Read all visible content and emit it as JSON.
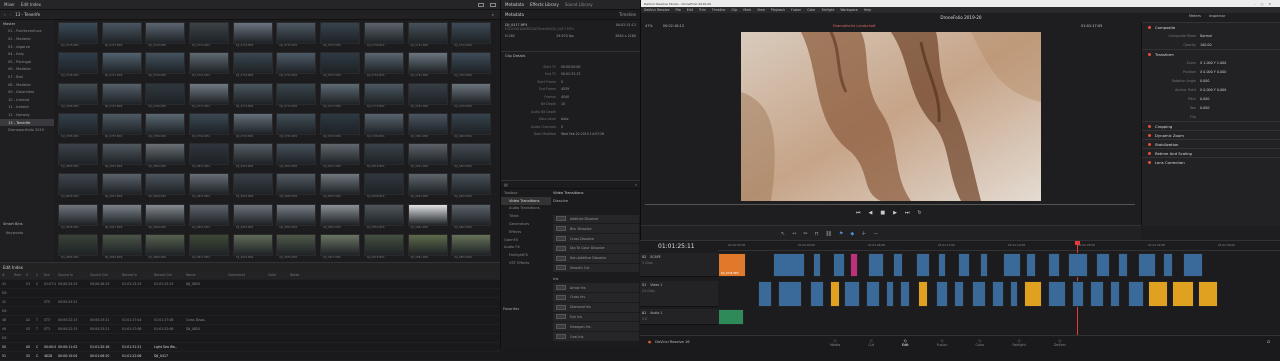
{
  "media_pool": {
    "toolbar_left": [
      "Mixer"
    ],
    "toolbar_items": [
      "Edit Index"
    ],
    "path": "13 - Tenerife",
    "master_label": "Master",
    "bins": [
      "01 - Fuerteventura",
      "02 - Madeira",
      "03 - Algarve",
      "04 - Italy",
      "05 - Portugal",
      "06 - Madeira",
      "07 - Bali",
      "08 - Madeira",
      "09 - Dolomites",
      "10 - Iceland",
      "11 - Ireland",
      "12 - Norway",
      "13 - Tenerife",
      "Droneportfolio 2019"
    ],
    "selected_bin": "13 - Tenerife",
    "smart_bins_label": "Smart Bins",
    "keywords_label": "Keywords",
    "thumbnails": [
      "DJI_0725.MP4",
      "DJI_0727.MP4",
      "DJI_0729.MP4",
      "DJI_0731.MP4",
      "DJI_0733.MP4",
      "DJI_0735.MP4",
      "DJI_0737.MP4",
      "DJI_0739.MP4",
      "DJI_0741.MP4",
      "DJI_0743.MP4",
      "DJI_0745.MP4",
      "DJI_0747.MP4",
      "DJI_0749.MP4",
      "DJI_0751.MP4",
      "DJI_0753.MP4",
      "DJI_0755.MP4",
      "DJI_0757.MP4",
      "DJI_0759.MP4",
      "DJI_0761.MP4",
      "DJI_0763.MP4",
      "DJI_0765.MP4",
      "DJI_0767.MP4",
      "DJI_0769.MP4",
      "DJI_0771.MP4",
      "DJI_0773.MP4",
      "DJI_0775.MP4",
      "DJI_0777.MP4",
      "DJI_0779.MP4",
      "DJI_0781.MP4",
      "DJI_0783.MP4",
      "DJI_0785.MP4",
      "DJI_0787.MP4",
      "DJI_0789.MP4",
      "DJI_0791.MP4",
      "DJI_0793.MP4",
      "DJI_0795.MP4",
      "DJI_0797.MP4",
      "DJI_0799.MP4",
      "DJI_0801.MP4",
      "DJI_0803.MP4",
      "DJI_0805.MP4",
      "DJI_0807.MP4",
      "DJI_0809.MP4",
      "DJI_0811.MP4",
      "DJI_0813.MP4",
      "DJI_0815.MP4",
      "DJI_0817.MP4",
      "DJI_0819.MP4",
      "DJI_0821.MP4",
      "DJI_0823.MP4",
      "DJI_0825.MP4",
      "DJI_0827.MP4",
      "DJI_0829.MP4",
      "DJI_0831.MP4",
      "DJI_0833.MP4",
      "DJI_0835.MP4",
      "DJI_0837.MP4",
      "DJI_0839.MP4",
      "DJI_0841.MP4",
      "DJI_0843.MP4",
      "DJI_0845.MP4",
      "DJI_0847.MP4",
      "DJI_0849.MP4",
      "DJI_0851.MP4",
      "DJI_0853.MP4",
      "DJI_0855.MP4",
      "DJI_0857.MP4",
      "DJI_0859.MP4",
      "DJI_0861.MP4",
      "DJI_0863.MP4",
      "DJI_0865.MP4",
      "DJI_0867.MP4",
      "DJI_0869.MP4",
      "DJI_0871.MP4",
      "DJI_0873.MP4",
      "DJI_0875.MP4",
      "DJI_0877.MP4",
      "DJI_0879.MP4",
      "DJI_0881.MP4",
      "DJI_0883.MP4"
    ],
    "thumb_colors": [
      "#3a4a58",
      "#4a5560",
      "#5b6470",
      "#3c4348",
      "#6a7380",
      "#4d5862",
      "#38434d",
      "#5c646b",
      "#465058",
      "#3d4a56",
      "#2f3d4a",
      "#526270",
      "#44525f",
      "#606a72",
      "#3a4650",
      "#4d5a66",
      "#2e3a44",
      "#5a6670",
      "#6c7680",
      "#3f4c58",
      "#404a4f",
      "#55606a",
      "#2f383f",
      "#707a82",
      "#4a565f",
      "#39444c",
      "#5e6a74",
      "#4b5761",
      "#363f46",
      "#6b747c",
      "#33404b",
      "#4e5a64",
      "#5a6872",
      "#3b4852",
      "#64707a",
      "#424e58",
      "#2d3942",
      "#58646e",
      "#4a5460",
      "#36424c",
      "#3c444a",
      "#50585f",
      "#6a7076",
      "#2f363c",
      "#565e64",
      "#46505a",
      "#60686e",
      "#3a4248",
      "#5c6268",
      "#444c52",
      "#3e464c",
      "#5a626a",
      "#4c545c",
      "#666e76",
      "#384046",
      "#525a62",
      "#70787e",
      "#30383e",
      "#5e666c",
      "#485058",
      "#6e767c",
      "#7a8288",
      "#848a90",
      "#5c646a",
      "#6a7278",
      "#767e84",
      "#8a9096",
      "#4e565c",
      "#e0e2e4",
      "#5a6268",
      "#3a4238",
      "#4a5446",
      "#56604e",
      "#3e4836",
      "#606a58",
      "#4e5848",
      "#6a7462",
      "#445040",
      "#5c6a4a",
      "#667258"
    ],
    "edit_index_title": "Edit Index",
    "edit_index_headers": [
      "#",
      "Reel",
      "V",
      "C",
      "Dur",
      "Source In",
      "Source Out",
      "Record In",
      "Record Out",
      "Name",
      "Comments",
      "Color",
      "Notes"
    ],
    "edit_index_rows": [
      [
        "41",
        "",
        "V1",
        "C",
        "01:07:22",
        "00:00:24:13",
        "00:00:26:13",
        "01:01:13:13",
        "01:01:15:13",
        "DJI_0830",
        "",
        "",
        ""
      ],
      [
        "M2",
        "",
        "",
        "",
        "",
        "",
        "",
        "",
        "",
        "",
        "",
        "",
        ""
      ],
      [
        "42",
        "",
        "",
        "",
        "ST5",
        "00:00:23:21",
        "",
        "",
        "",
        "",
        "",
        "",
        ""
      ],
      [
        "M2",
        "",
        "",
        "",
        "",
        "",
        "",
        "",
        "",
        "",
        "",
        "",
        ""
      ],
      [
        "48",
        "",
        "A2",
        "T",
        "ST3",
        "00:00:22:13",
        "00:00:23:21",
        "01:01:17:04",
        "01:01:17:08",
        "Cross Disso..",
        "",
        "",
        ""
      ],
      [
        "49",
        "",
        "V2",
        "T",
        "ST3",
        "00:00:22:13",
        "00:00:23:21",
        "01:01:17:08",
        "01:01:22:08",
        "DJI_0820",
        "",
        "",
        ""
      ],
      [
        "M2",
        "",
        "",
        "",
        "",
        "",
        "",
        "",
        "",
        "",
        "",
        "",
        ""
      ],
      [
        "50",
        "",
        "A5",
        "C",
        "00:00:00",
        "00:00:11:02",
        "01:01:20:18",
        "01:01:31:21",
        "Light Sea Wa..",
        "",
        "",
        "",
        ""
      ],
      [
        "51",
        "",
        "V2",
        "C",
        "4K28",
        "00:00:15:04",
        "00:01:06:20",
        "01:01:22:08",
        "DJI_0417",
        "",
        "",
        "",
        ""
      ]
    ]
  },
  "metadata": {
    "tabs": [
      "Metadata",
      "Effects Library",
      "Sound Library"
    ],
    "header_title": "Metadata",
    "header_sub": "Timeline",
    "clip_name": "DJI_0417.MP4",
    "clip_path": "E:\\DCIM\\100MEDIA\\Tenerife\\DJI_0417.MP4",
    "clip_duration": "00:02:31:13",
    "codec": "H.265",
    "fps": "29.970 fps",
    "resolution": "3840 x 2160",
    "details_title": "Clip Details",
    "details": [
      [
        "Start TC",
        "00:00:00:00"
      ],
      [
        "End TC",
        "00:02:31:13"
      ],
      [
        "Start Frame",
        "0"
      ],
      [
        "End Frame",
        "4539"
      ],
      [
        "Frames",
        "4540"
      ],
      [
        "Bit Depth",
        "10"
      ],
      [
        "Audio Bit Depth",
        ""
      ],
      [
        "Data Level",
        "Auto"
      ],
      [
        "Audio Channels",
        "0"
      ],
      [
        "Date Modified",
        "Wed Feb 20 2019 14:57:26"
      ]
    ]
  },
  "effects": {
    "tree": [
      "Toolbox",
      "Video Transitions",
      "Audio Transitions",
      "Titles",
      "Generators",
      "Effects",
      "OpenFX",
      "Audio FX",
      "FairlightFX",
      "VST Effects"
    ],
    "tree_selected": "Video Transitions",
    "favorites_label": "Favorites",
    "list_title": "Video Transitions",
    "group1": "Dissolve",
    "dissolves": [
      "Additive Dissolve",
      "Blur Dissolve",
      "Cross Dissolve",
      "Dip To Color Dissolve",
      "Non-Additive Dissolve",
      "Smooth Cut"
    ],
    "group2": "Iris",
    "iris": [
      "Arrow Iris",
      "Cross Iris",
      "Diamond Iris",
      "Eye Iris",
      "Hexagon Iris",
      "Oval Iris"
    ]
  },
  "viewer": {
    "window_title": "DaVinci Resolve Studio - DroneFolio 2019-20",
    "menu": [
      "DaVinci Resolve",
      "File",
      "Edit",
      "Trim",
      "Timeline",
      "Clip",
      "Mark",
      "View",
      "Playback",
      "Fusion",
      "Color",
      "Fairlight",
      "Workspace",
      "Help"
    ],
    "project_title": "DroneFolio 2019-20",
    "zoom": "47%",
    "source_tc": "00:02:18:13",
    "clip_label": "Dramatische Landschaft",
    "timeline_tc": "01:01:17:05",
    "top_right": [
      "Meters",
      "Inspector"
    ]
  },
  "inspector": {
    "sections": [
      {
        "title": "Composite",
        "rows": [
          [
            "Composite Mode",
            "Normal"
          ],
          [
            "Opacity",
            "100.00"
          ]
        ]
      },
      {
        "title": "Transform",
        "rows": [
          [
            "Zoom",
            "X 1.000   Y 1.000"
          ],
          [
            "Position",
            "X 0.000   Y 0.000"
          ],
          [
            "Rotation Angle",
            "0.000"
          ],
          [
            "Anchor Point",
            "X 0.000   Y 0.000"
          ],
          [
            "Pitch",
            "0.000"
          ],
          [
            "Yaw",
            "0.000"
          ],
          [
            "Flip",
            ""
          ]
        ]
      },
      {
        "title": "Cropping",
        "rows": []
      },
      {
        "title": "Dynamic Zoom",
        "rows": []
      },
      {
        "title": "Stabilization",
        "rows": []
      },
      {
        "title": "Retime And Scaling",
        "rows": []
      },
      {
        "title": "Lens Correction",
        "rows": []
      }
    ]
  },
  "timeline": {
    "timecode": "01:01:25:11",
    "ruler": [
      "01:00:54:08",
      "01:01:00:00",
      "01:01:06:08",
      "01:01:13:00",
      "01:01:19:08",
      "01:01:26:00",
      "01:01:32:08",
      "01:01:39:00"
    ],
    "tracks": [
      {
        "id": "V2",
        "name": "SCAPE",
        "sub": "3 Clips"
      },
      {
        "id": "V1",
        "name": "Video 1",
        "sub": "24 Clips"
      },
      {
        "id": "A1",
        "name": "Audio 1",
        "sub": "2.0"
      }
    ],
    "first_clip_label": "DJI_0744.MP4"
  },
  "pages": {
    "app_name": "DaVinci Resolve 16",
    "items": [
      "Media",
      "Cut",
      "Edit",
      "Fusion",
      "Color",
      "Fairlight",
      "Deliver"
    ],
    "active": "Edit"
  }
}
